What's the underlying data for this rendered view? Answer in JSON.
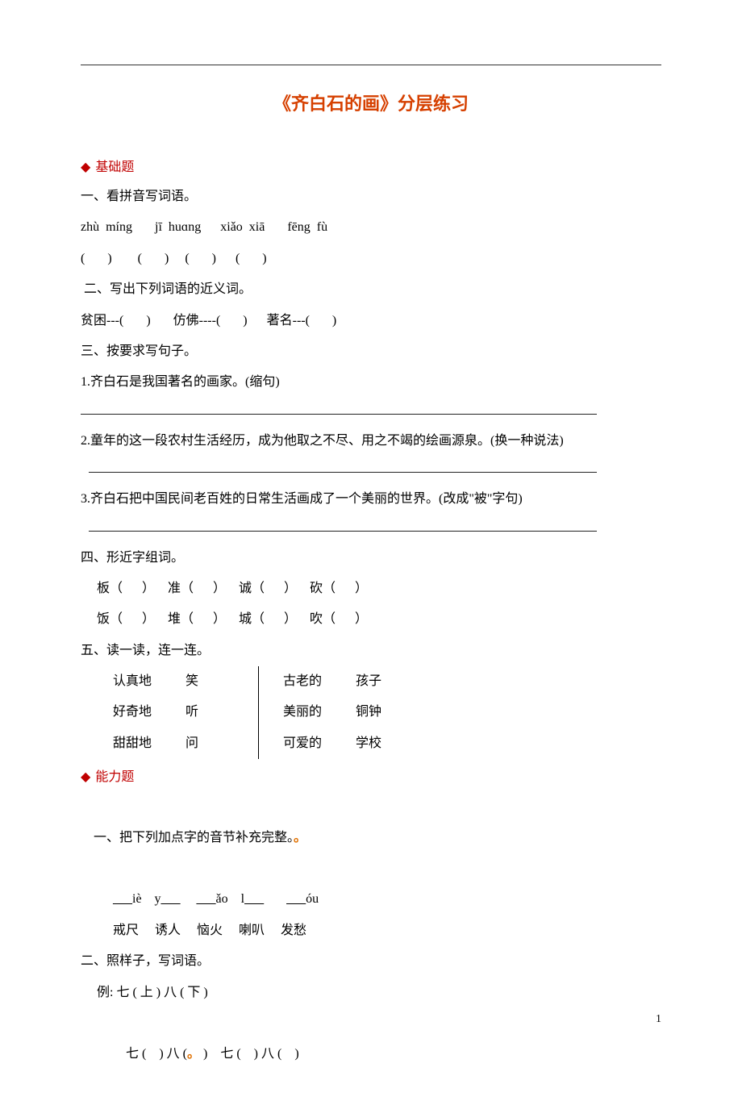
{
  "title": "《齐白石的画》分层练习",
  "sections": {
    "basic": "基础题",
    "ability": "能力题"
  },
  "q1": {
    "heading": "一、看拼音写词语。",
    "pinyin": "zhù  míng       jī  huɑng      xiǎo  xiā       fēng  fù",
    "blanks": "(       )        (       )     (       )      (       )"
  },
  "q2": {
    "heading": " 二、写出下列词语的近义词。",
    "content": "贫困---(       )       仿佛----(       )      著名---(       )"
  },
  "q3": {
    "heading": "三、按要求写句子。",
    "item1": "1.齐白石是我国著名的画家。(缩句)",
    "item2": "2.童年的这一段农村生活经历，成为他取之不尽、用之不竭的绘画源泉。(换一种说法)",
    "item3": "3.齐白石把中国民间老百姓的日常生活画成了一个美丽的世界。(改成\"被\"字句)"
  },
  "q4": {
    "heading": "四、形近字组词。",
    "row1": "     板（      ）    准（      ）    诚（      ）    砍（      ）",
    "row2": "     饭（      ）    堆（      ）    城（      ）    吹（      ）"
  },
  "q5": {
    "heading": "五、读一读，连一连。",
    "rows": [
      {
        "l1": "认真地",
        "l2": "笑",
        "r1": "古老的",
        "r2": "孩子"
      },
      {
        "l1": "好奇地",
        "l2": "听",
        "r1": "美丽的",
        "r2": "铜钟"
      },
      {
        "l1": "甜甜地",
        "l2": "问",
        "r1": "可爱的",
        "r2": "学校"
      }
    ]
  },
  "ab1": {
    "heading_pre": "一、把下列加点字的音节补充完整。",
    "pinyin": "   iè    y         ǎo    l           óu",
    "u1": "___",
    "u2": "___",
    "u3": "___",
    "u4": "___",
    "u5": "___",
    "words": "戒尺     诱人     恼火     喇叭     发愁"
  },
  "ab2": {
    "heading": "二、照样子，写词语。",
    "example": "     例: 七 ( 上 ) 八 ( 下 )",
    "blanks_pre": "          七 (    ) 八 (",
    "blanks_post": " )    七 (    ) 八 (    )"
  },
  "page_number": "1"
}
